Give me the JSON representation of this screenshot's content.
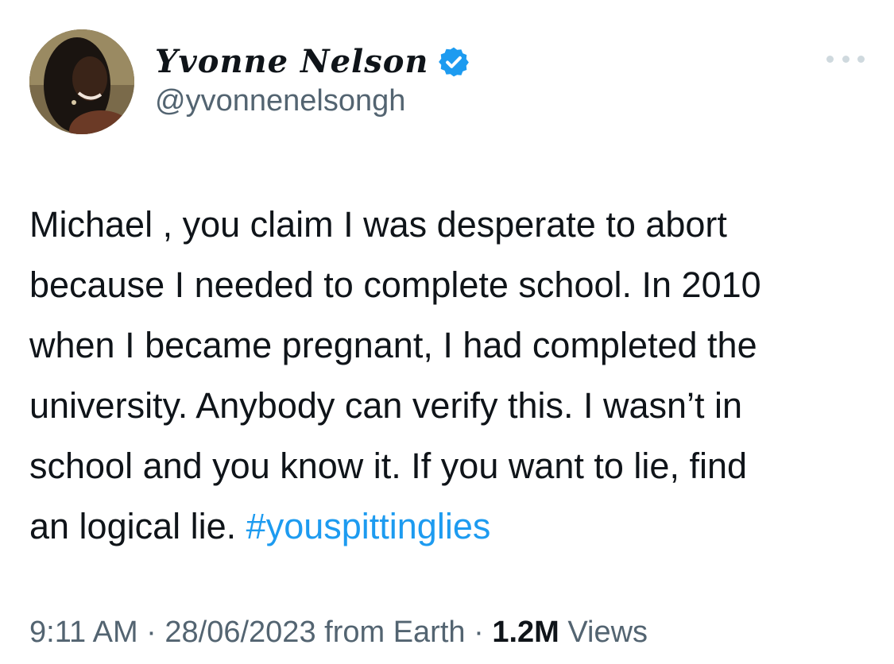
{
  "author": {
    "display_name": "Yvonne Nelson",
    "handle": "@yvonnenelsongh",
    "avatar_icon": "profile-photo",
    "verified_icon": "verified-badge-icon",
    "verified_color": "#1d9bf0"
  },
  "menu": {
    "more_icon": "more-options-icon"
  },
  "tweet": {
    "lines": [
      "Michael , you claim I was desperate to abort",
      "because I needed to complete school. In 2010",
      "when I became pregnant, I had completed the",
      "university. Anybody can verify this. I wasn’t in",
      "school and you know it. If you want to lie, find",
      "an logical lie."
    ],
    "hashtag": "#youspittinglies"
  },
  "meta": {
    "time": "9:11 AM",
    "separator": "·",
    "date": "28/06/2023",
    "source": "from Earth",
    "views_count": "1.2M",
    "views_label": "Views"
  },
  "colors": {
    "text": "#0f1419",
    "secondary": "#536471",
    "link": "#1d9bf0"
  }
}
